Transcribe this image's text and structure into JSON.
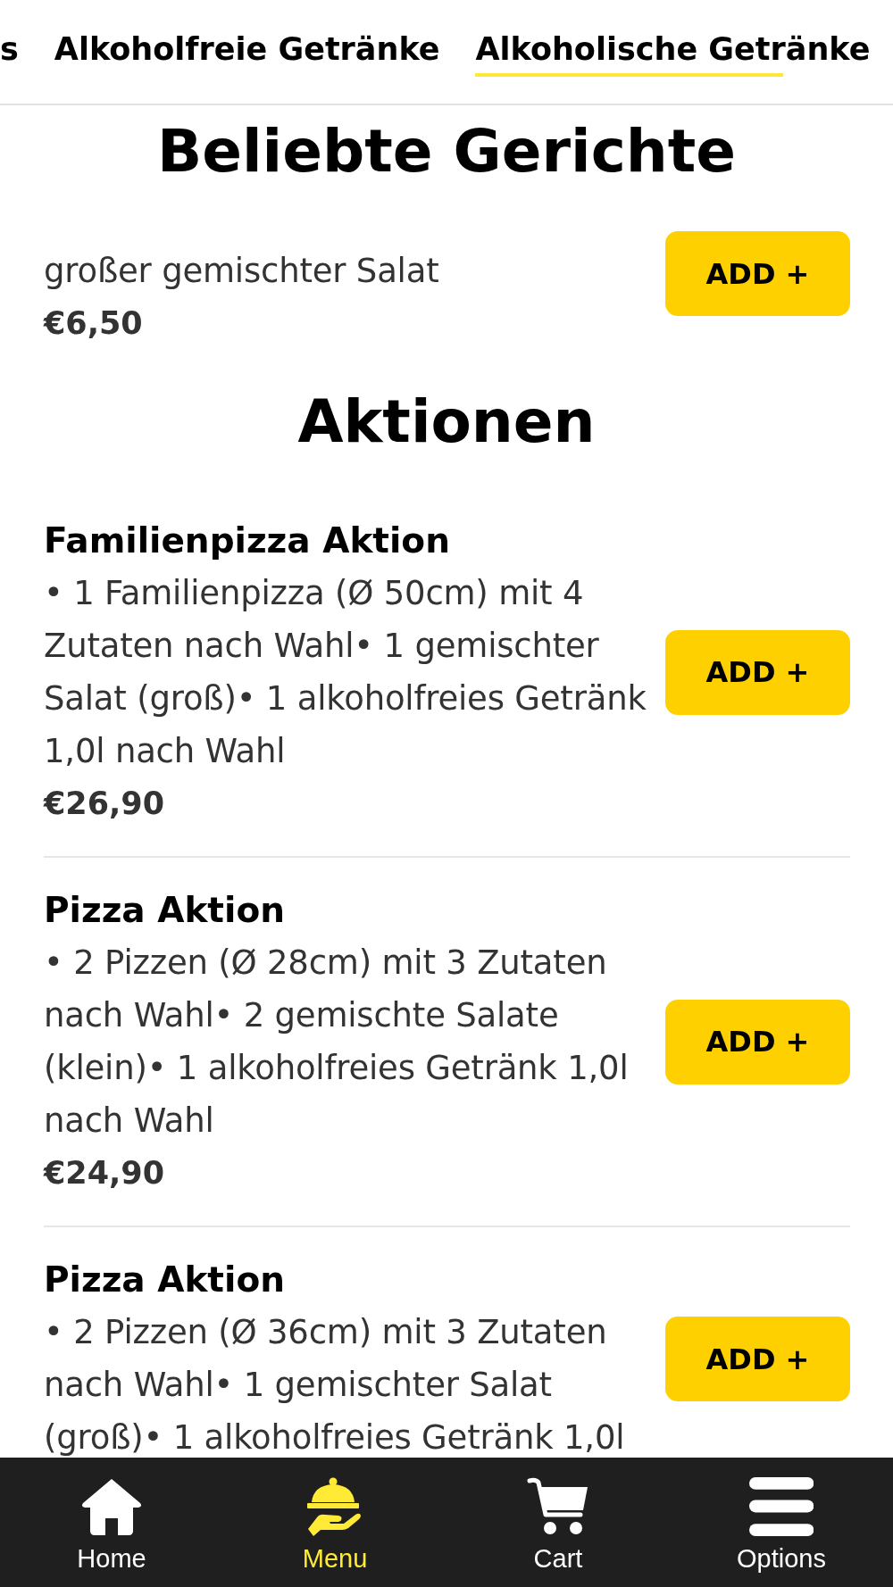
{
  "tabs": [
    {
      "label": "s",
      "selected": false
    },
    {
      "label": "Alkoholfreie Getränke",
      "selected": false
    },
    {
      "label": "Alkoholische Getränke",
      "selected": true
    }
  ],
  "sections": [
    {
      "heading": "Beliebte Gerichte",
      "items": [
        {
          "description": "großer gemischter Salat",
          "price": "€6,50",
          "button": "ADD +"
        }
      ]
    },
    {
      "heading": "Aktionen",
      "items": [
        {
          "title": "Familienpizza Aktion",
          "description": "• 1 Familienpizza (Ø 50cm) mit 4 Zutaten nach Wahl• 1 gemischter Salat (groß)• 1 alkoholfreies Getränk 1,0l nach Wahl",
          "price": "€26,90",
          "button": "ADD +"
        },
        {
          "title": "Pizza Aktion",
          "description": "• 2 Pizzen (Ø 28cm) mit 3 Zutaten nach Wahl• 2 gemischte Salate (klein)• 1 alkoholfreies Getränk 1,0l nach Wahl",
          "price": "€24,90",
          "button": "ADD +"
        },
        {
          "title": "Pizza Aktion",
          "description": "• 2 Pizzen (Ø 36cm) mit 3 Zutaten nach Wahl• 1 gemischter Salat (groß)• 1 alkoholfreies Getränk 1,0l",
          "button": "ADD +"
        }
      ]
    }
  ],
  "bottom_nav": [
    {
      "label": "Home",
      "selected": false
    },
    {
      "label": "Menu",
      "selected": true
    },
    {
      "label": "Cart",
      "selected": false
    },
    {
      "label": "Options",
      "selected": false
    }
  ]
}
